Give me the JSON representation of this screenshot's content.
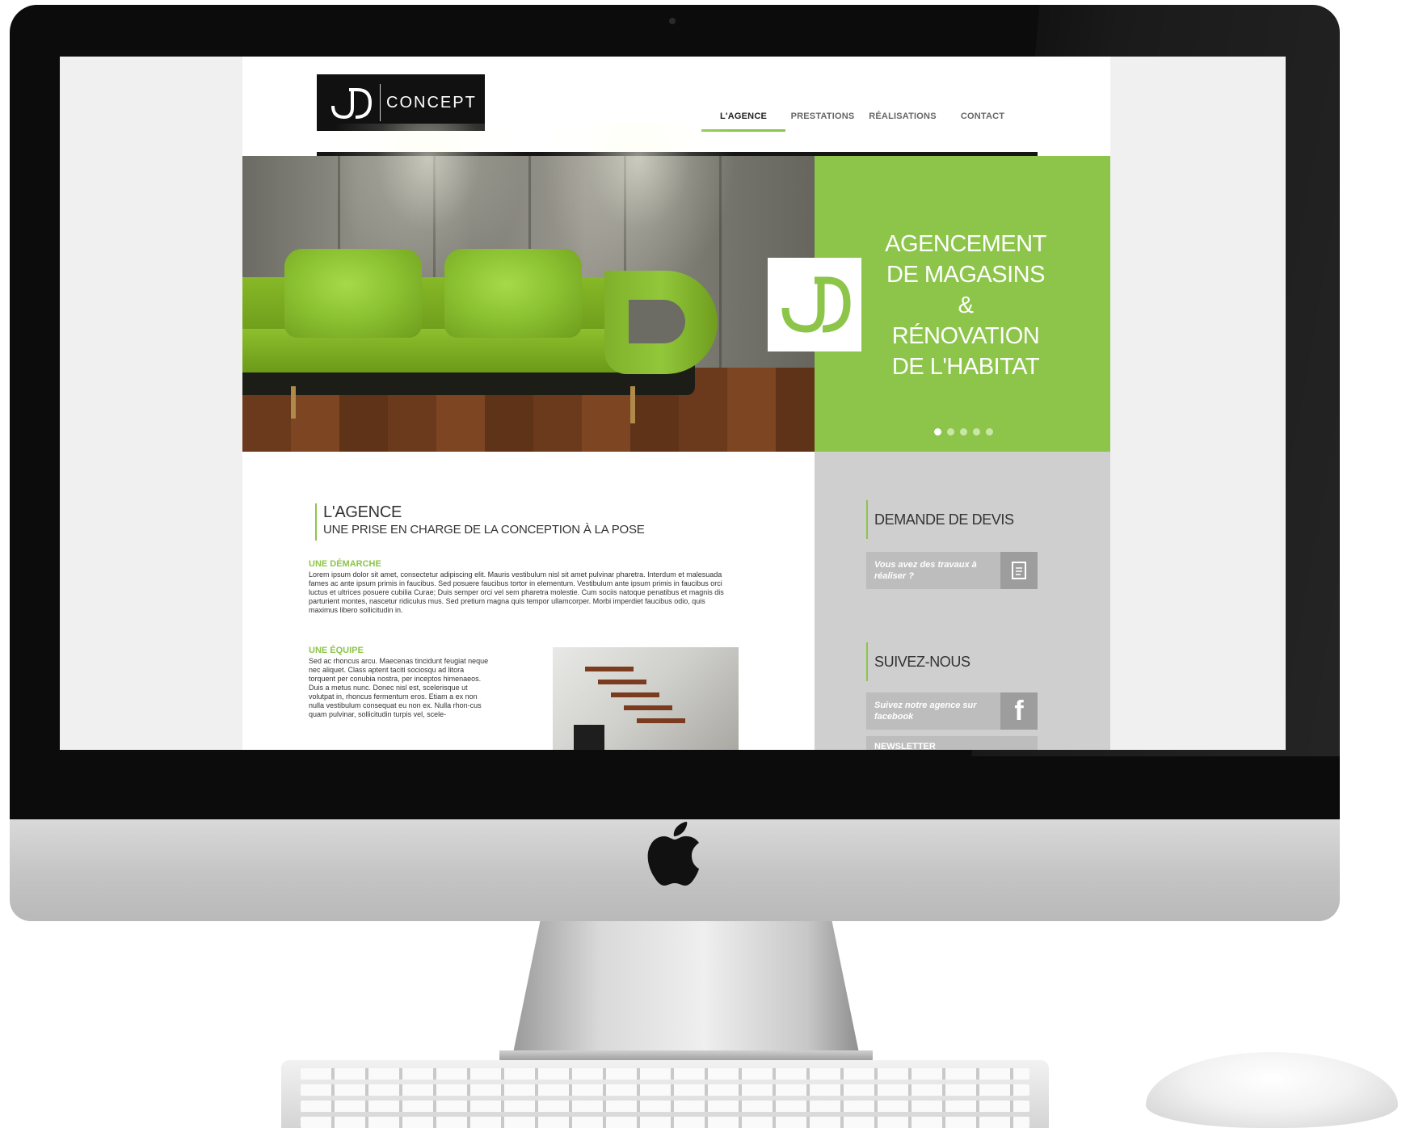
{
  "site": {
    "logo_text": "CONCEPT",
    "nav": [
      {
        "label": "L'AGENCE",
        "active": true
      },
      {
        "label": "PRESTATIONS",
        "active": false
      },
      {
        "label": "RÉALISATIONS",
        "active": false
      },
      {
        "label": "CONTACT",
        "active": false
      }
    ],
    "hero": {
      "lines": [
        "AGENCEMENT",
        "DE MAGASINS",
        "&",
        "RÉNOVATION",
        "DE L'HABITAT"
      ],
      "slides": 5,
      "active_slide": 1
    },
    "agence": {
      "title": "L'AGENCE",
      "subtitle": "UNE PRISE EN CHARGE DE LA CONCEPTION À LA POSE",
      "demarche_heading": "UNE DÉMARCHE",
      "demarche_text": "Lorem ipsum dolor sit amet, consectetur adipiscing elit. Mauris vestibulum nisl sit amet pulvinar pharetra. Interdum et malesuada fames ac ante ipsum primis in faucibus. Sed posuere faucibus tortor in elementum. Vestibulum ante ipsum primis in faucibus orci luctus et ultrices posuere cubilia Curae; Duis semper orci vel sem pharetra molestie. Cum sociis natoque penatibus et magnis dis parturient montes, nascetur ridiculus mus. Sed pretium magna quis tempor ullamcorper. Morbi imperdiet faucibus odio, quis maximus libero sollicitudin in.",
      "equipe_heading": "UNE ÉQUIPE",
      "equipe_text": "Sed ac rhoncus arcu. Maecenas tincidunt feugiat neque nec aliquet. Class aptent taciti sociosqu ad litora torquent per conubia nostra, per inceptos himenaeos. Duis a metus nunc. Donec nisl est, scelerisque ut volutpat in, rhoncus fermentum eros. Etiam a ex non nulla vestibulum consequat eu non ex. Nulla rhon-cus quam pulvinar, sollicitudin turpis vel, scele-"
    },
    "sidebar": {
      "devis_title": "DEMANDE DE DEVIS",
      "devis_button": "Vous avez des travaux à réaliser ?",
      "devis_icon": "document-icon",
      "follow_title": "SUIVEZ-NOUS",
      "facebook_button": "Suivez notre agence sur facebook",
      "facebook_icon": "facebook-icon",
      "newsletter_partial": "NEWSLETTER"
    },
    "colors": {
      "accent": "#8cc54a",
      "sidebar_bg": "#cfcfcf",
      "logo_bg": "#111111"
    }
  }
}
